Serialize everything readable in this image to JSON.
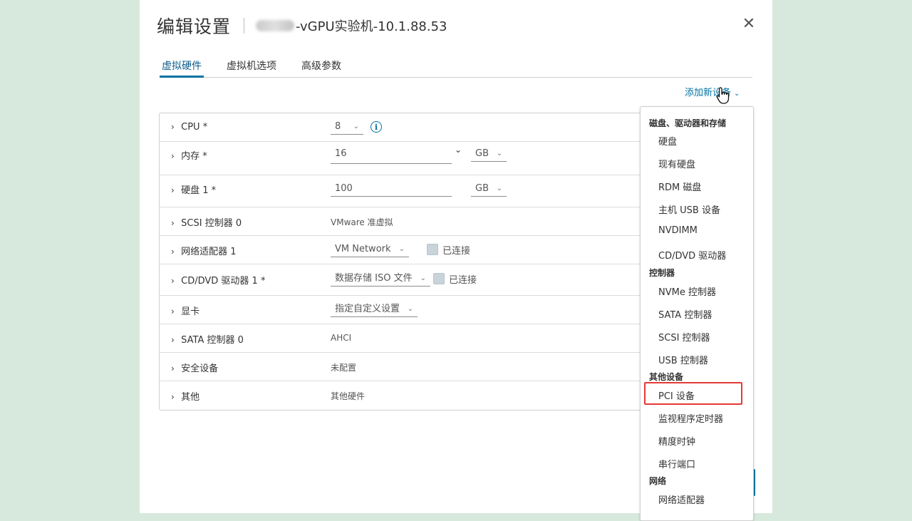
{
  "header": {
    "title": "编辑设置",
    "vm_name": "-vGPU实验机-10.1.88.53",
    "close_glyph": "✕"
  },
  "tabs": [
    {
      "label": "虚拟硬件",
      "active": true
    },
    {
      "label": "虚拟机选项",
      "active": false
    },
    {
      "label": "高级参数",
      "active": false
    }
  ],
  "add_device": {
    "label": "添加新设备"
  },
  "hardware": {
    "cpu": {
      "label": "CPU *",
      "value": "8"
    },
    "memory": {
      "label": "内存 *",
      "value": "16",
      "unit": "GB"
    },
    "disk": {
      "label": "硬盘 1 *",
      "value": "100",
      "unit": "GB"
    },
    "scsi": {
      "label": "SCSI 控制器 0",
      "value": "VMware 准虚拟"
    },
    "network": {
      "label": "网络适配器 1",
      "value": "VM Network",
      "connected_label": "已连接"
    },
    "cddvd": {
      "label": "CD/DVD 驱动器 1 *",
      "value": "数据存储 ISO 文件",
      "connected_label": "已连接"
    },
    "gpu": {
      "label": "显卡",
      "value": "指定自定义设置"
    },
    "sata": {
      "label": "SATA 控制器 0",
      "value": "AHCI"
    },
    "security": {
      "label": "安全设备",
      "value": "未配置"
    },
    "other": {
      "label": "其他",
      "value": "其他硬件"
    }
  },
  "menu": {
    "storage_header": "磁盘、驱动器和存储",
    "storage_items": [
      "硬盘",
      "现有硬盘",
      "RDM 磁盘",
      "主机 USB 设备",
      "NVDIMM",
      "CD/DVD 驱动器"
    ],
    "controller_header": "控制器",
    "controller_items": [
      "NVMe 控制器",
      "SATA 控制器",
      "SCSI 控制器",
      "USB 控制器"
    ],
    "other_header": "其他设备",
    "other_items": [
      "PCI 设备",
      "监视程序定时器",
      "精度时钟",
      "串行端口"
    ],
    "network_header": "网络",
    "network_items": [
      "网络适配器"
    ]
  },
  "colors": {
    "accent": "#0072a3",
    "highlight": "#e53935",
    "backdrop": "#d7e8dc"
  }
}
